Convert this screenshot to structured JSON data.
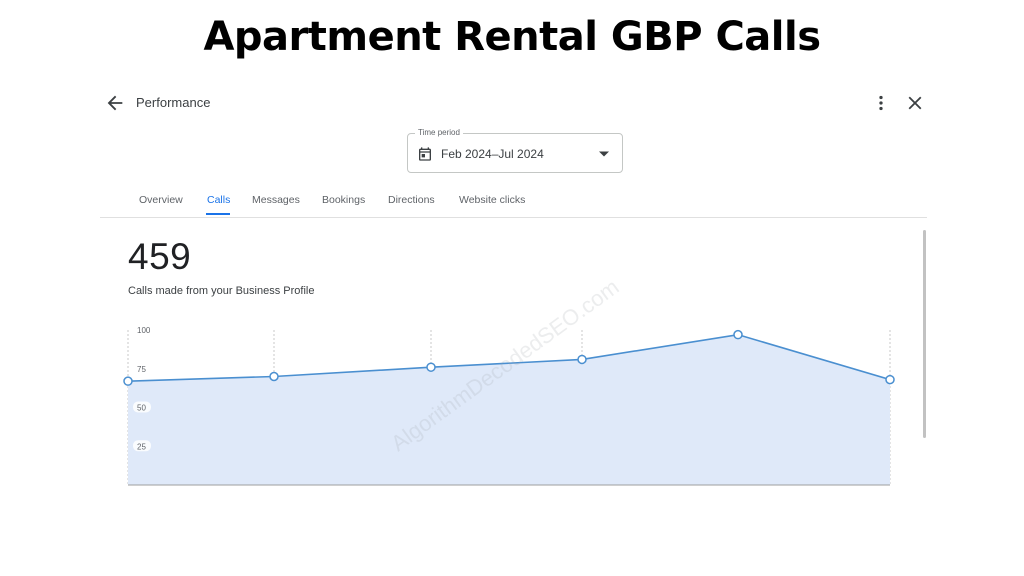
{
  "headline": "Apartment Rental GBP Calls",
  "topbar": {
    "title": "Performance",
    "back_icon": "arrow-left-icon",
    "more_icon": "more-vertical-icon",
    "close_icon": "close-icon"
  },
  "time_period": {
    "label": "Time period",
    "value": "Feb 2024–Jul 2024",
    "icon": "calendar-icon"
  },
  "tabs": [
    {
      "label": "Overview",
      "active": false
    },
    {
      "label": "Calls",
      "active": true
    },
    {
      "label": "Messages",
      "active": false
    },
    {
      "label": "Bookings",
      "active": false
    },
    {
      "label": "Directions",
      "active": false
    },
    {
      "label": "Website clicks",
      "active": false
    }
  ],
  "metric": {
    "value": "459",
    "caption": "Calls made from your Business Profile"
  },
  "watermark": "AlgorithmDecodedSEO.com",
  "colors": {
    "accent": "#1a73e8",
    "line": "#4a8fd0",
    "area": "#dfe9f9"
  },
  "chart_data": {
    "type": "area",
    "ylim": [
      0,
      100
    ],
    "y_ticks": [
      "100",
      "75",
      "50",
      "25"
    ],
    "values": [
      67,
      70,
      76,
      81,
      97,
      68
    ],
    "grid": "dotted vertical"
  }
}
